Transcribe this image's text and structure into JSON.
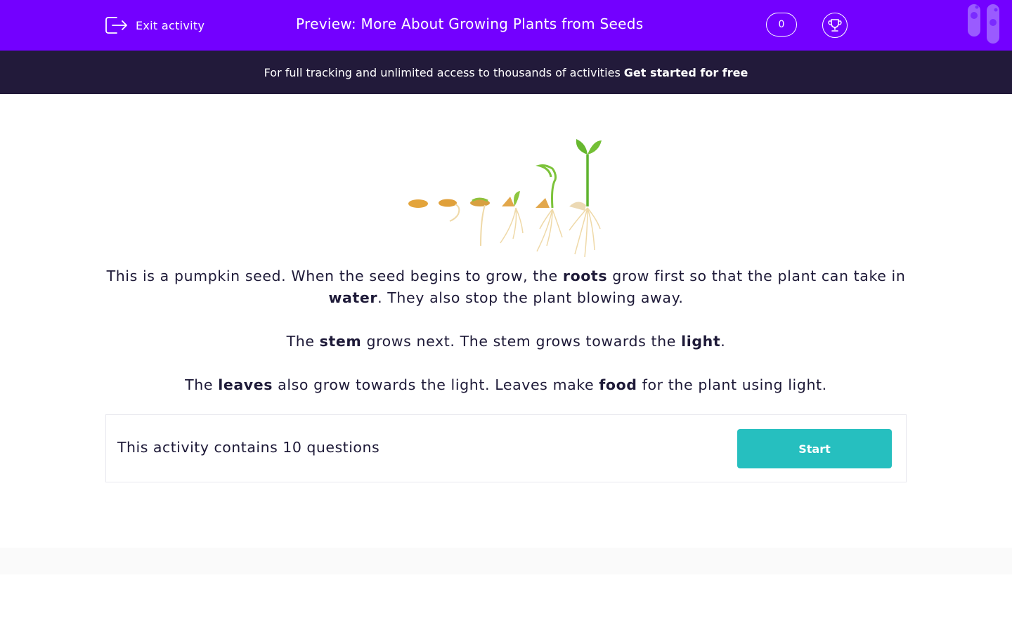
{
  "header": {
    "exit_label": "Exit activity",
    "title": "Preview: More About Growing Plants from Seeds",
    "score": "0"
  },
  "banner": {
    "text": "For full tracking and unlimited access to thousands of activities",
    "cta": "Get started for free"
  },
  "content": {
    "p1": {
      "t1": "This is a pumpkin seed. When the seed begins to grow, the ",
      "b1": "roots",
      "t2": " grow first so that the plant can take in ",
      "b2": "water",
      "t3": ". They also stop the plant blowing away."
    },
    "p2": {
      "t1": "The ",
      "b1": "stem",
      "t2": " grows next. The stem grows towards the ",
      "b2": "light",
      "t3": "."
    },
    "p3": {
      "t1": "The ",
      "b1": "leaves",
      "t2": " also grow towards the light. Leaves make ",
      "b2": "food",
      "t3": " for the plant using light."
    }
  },
  "activity": {
    "label": "This activity contains 10 questions",
    "start_label": "Start"
  },
  "colors": {
    "header_bg": "#7300ff",
    "banner_bg": "#221a3a",
    "start_button": "#26bfbf",
    "text": "#1e1a38"
  },
  "icons": [
    "exit-icon",
    "trophy-icon"
  ]
}
